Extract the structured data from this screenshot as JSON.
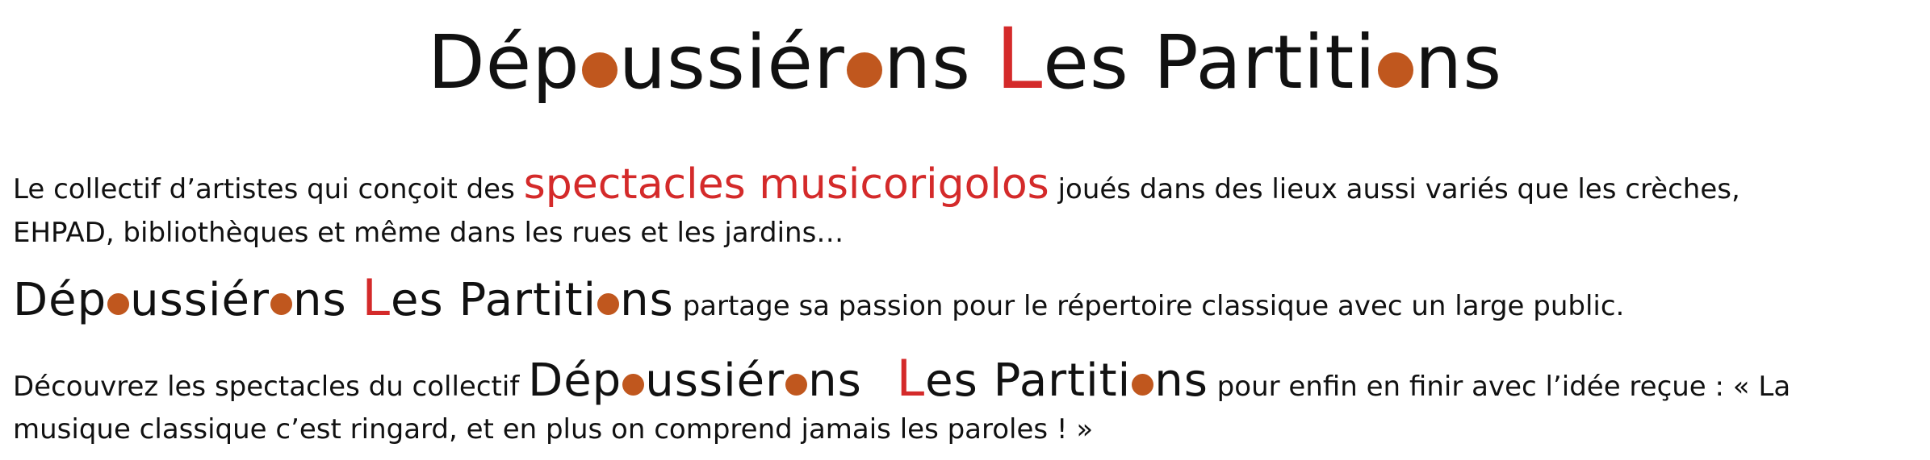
{
  "title": {
    "part1": "Dép",
    "part2": "ussiér",
    "part3": "ns ",
    "letterL": "L",
    "part4": "es Partiti",
    "part5": "ns"
  },
  "paragraph": {
    "line1_before": "Le collectif d’artistes qui conçoit des ",
    "line1_highlight": "spectacles musicorigolos",
    "line1_after": " joués dans des lieux aussi variés que les crèches,",
    "line2": "EHPAD, bibliothèques et même dans les rues et les jardins…",
    "line3_after": " partage sa passion pour le répertoire classique avec un large public.",
    "line4_before": "Découvrez les spectacles du collectif ",
    "line4_after": "  pour enfin en finir avec l’idée reçue : « La",
    "line5": "musique classique c’est ringard, et en plus on comprend jamais les paroles ! »"
  },
  "colors": {
    "accent_red": "#d42a2a",
    "dot_orange": "#c0571e",
    "text": "#111111"
  }
}
